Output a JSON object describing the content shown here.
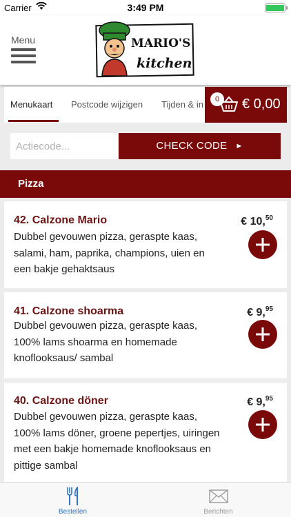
{
  "status": {
    "carrier": "Carrier",
    "time": "3:49 PM"
  },
  "header": {
    "menu_label": "Menu",
    "logo_text_1": "MARIO'S",
    "logo_text_2": "kitchen"
  },
  "tabs": [
    {
      "label": "Menukaart",
      "active": true
    },
    {
      "label": "Postcode wijzigen",
      "active": false
    },
    {
      "label": "Tijden & in",
      "active": false
    }
  ],
  "cart": {
    "count": "0",
    "total": "€ 0,00"
  },
  "action": {
    "placeholder": "Actiecode...",
    "button_label": "CHECK CODE"
  },
  "category": {
    "name": "Pizza"
  },
  "products": [
    {
      "name": "42. Calzone Mario",
      "desc": "Dubbel gevouwen pizza, geraspte kaas, salami, ham, paprika, champions, uien en een bakje gehaktsaus",
      "price_main": "€ 10,",
      "price_cents": "50"
    },
    {
      "name": "41. Calzone shoarma",
      "desc": "Dubbel gevouwen pizza, geraspte kaas, 100% lams shoarma en homemade knoflooksaus/ sambal",
      "price_main": "€ 9,",
      "price_cents": "95"
    },
    {
      "name": "40. Calzone döner",
      "desc": "Dubbel gevouwen pizza, geraspte kaas, 100% lams döner, groene pepertjes, uiringen met een bakje homemade knoflooksaus en pittige sambal",
      "price_main": "€ 9,",
      "price_cents": "95"
    }
  ],
  "tabbar": [
    {
      "label": "Bestellen",
      "icon": "cutlery-icon",
      "active": true
    },
    {
      "label": "Berichten",
      "icon": "envelope-icon",
      "active": false
    }
  ],
  "colors": {
    "brand": "#7a0a0a",
    "product_name": "#6b1414",
    "active_tab": "#2e74c9",
    "battery": "#35c759"
  }
}
